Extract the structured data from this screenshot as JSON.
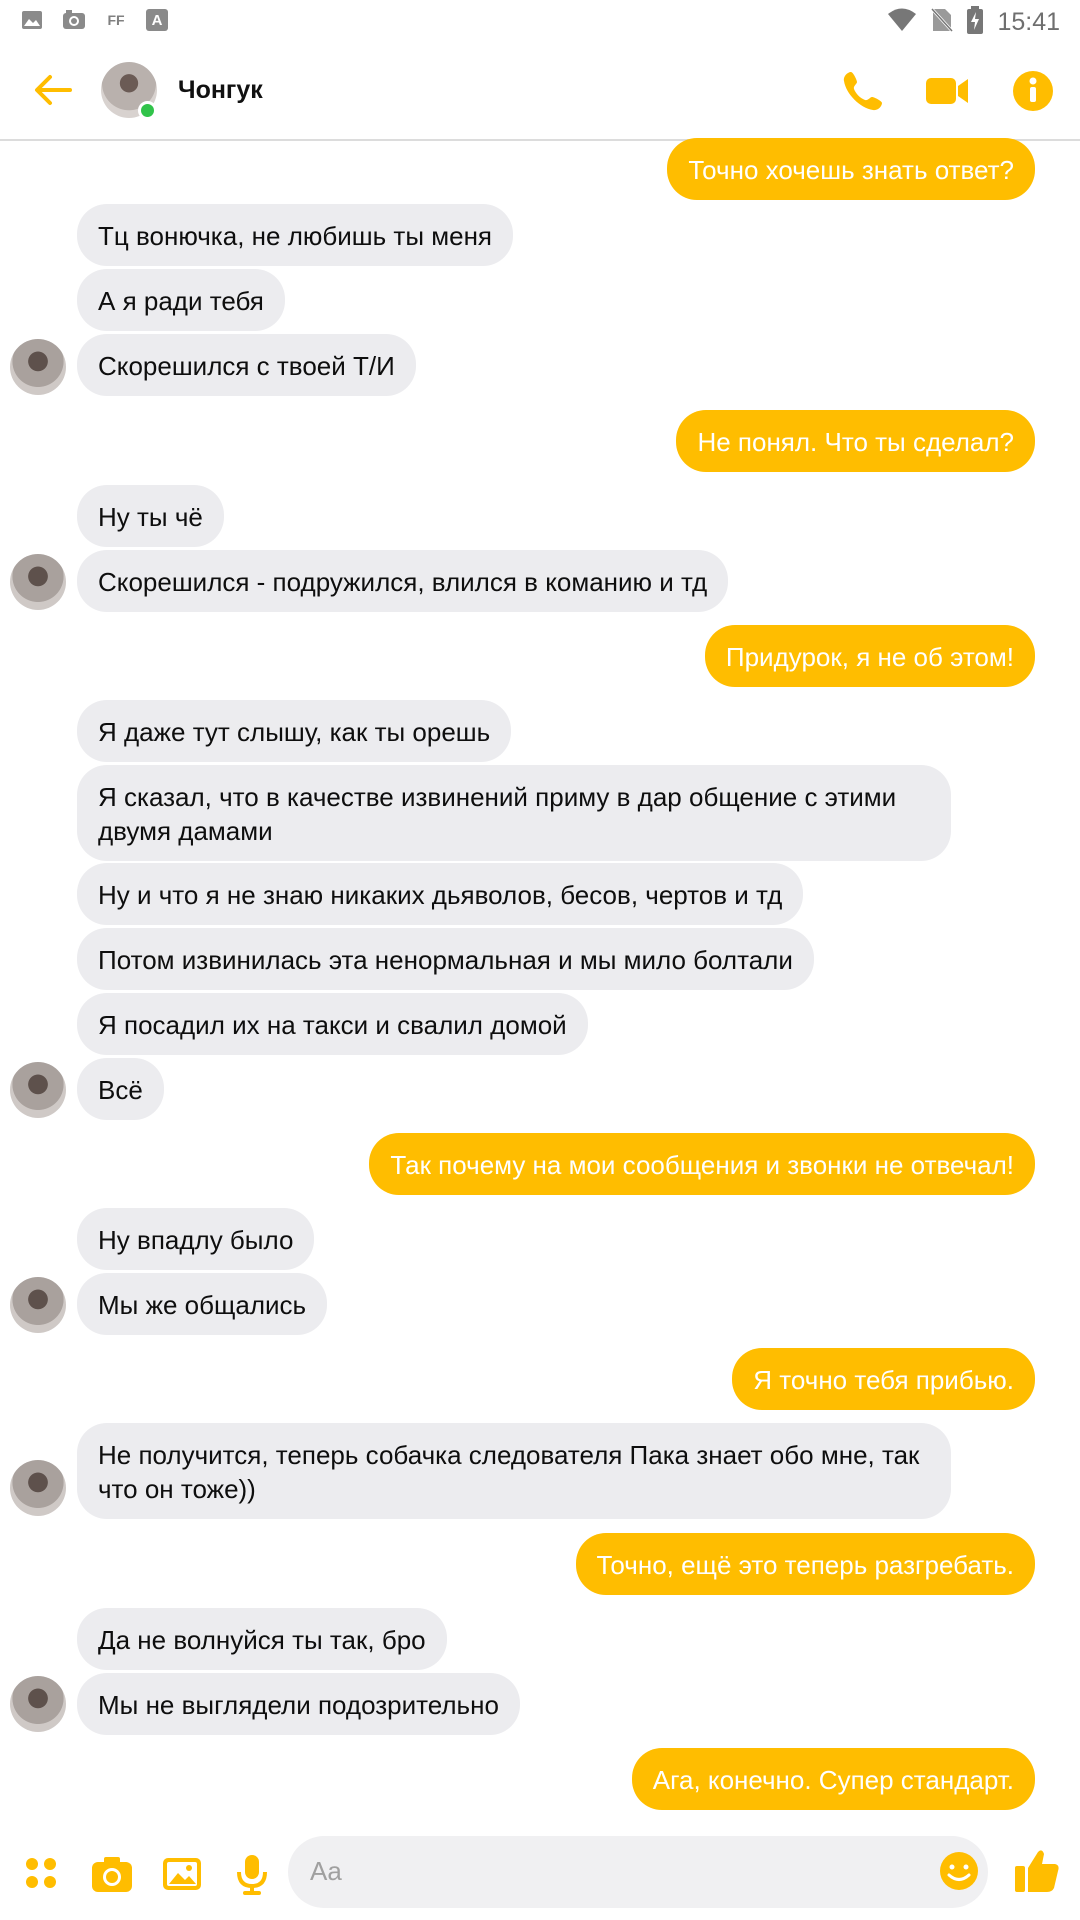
{
  "status_bar": {
    "time": "15:41",
    "left_icons": [
      "image-icon",
      "camera-notif-icon",
      "ff-icon",
      "a-icon"
    ],
    "ff_label": "FF",
    "a_label": "A"
  },
  "header": {
    "contact_name": "Чонгук",
    "online": true
  },
  "colors": {
    "accent": "#ffbd00",
    "incoming_bubble": "#ececef",
    "online": "#31c34a"
  },
  "messages": [
    {
      "dir": "out",
      "text": "Точно хочешь знать ответ?"
    },
    {
      "dir": "in",
      "text": "Тц вонючка, не любишь ты меня"
    },
    {
      "dir": "in",
      "text": "А я ради тебя"
    },
    {
      "dir": "in",
      "text": "Скорешился с твоей Т/И"
    },
    {
      "dir": "out",
      "text": "Не понял. Что ты сделал?"
    },
    {
      "dir": "in",
      "text": "Ну ты чё"
    },
    {
      "dir": "in",
      "text": "Скорешился - подружился, влился в команию и тд"
    },
    {
      "dir": "out",
      "text": "Придурок, я не об этом!"
    },
    {
      "dir": "in",
      "text": "Я даже тут слышу, как ты орешь"
    },
    {
      "dir": "in",
      "text": "Я сказал, что в качестве извинений приму в дар общение с этими двумя дамами"
    },
    {
      "dir": "in",
      "text": "Ну и что я не знаю никаких дьяволов, бесов, чертов и тд"
    },
    {
      "dir": "in",
      "text": "Потом извинилась эта ненормальная и мы мило болтали"
    },
    {
      "dir": "in",
      "text": "Я посадил их на такси и свалил домой"
    },
    {
      "dir": "in",
      "text": "Всё"
    },
    {
      "dir": "out",
      "text": "Так почему на мои сообщения и звонки не отвечал!"
    },
    {
      "dir": "in",
      "text": "Ну впадлу было"
    },
    {
      "dir": "in",
      "text": "Мы же общались"
    },
    {
      "dir": "out",
      "text": "Я точно тебя прибью."
    },
    {
      "dir": "in",
      "text": "Не получится, теперь собачка следователя Пака знает обо мне, так что он тоже))"
    },
    {
      "dir": "out",
      "text": "Точно, ещё это теперь разгребать."
    },
    {
      "dir": "in",
      "text": "Да не волнуйся ты так, бро"
    },
    {
      "dir": "in",
      "text": "Мы не выглядели подозрительно"
    },
    {
      "dir": "out",
      "text": "Ага, конечно. Супер стандарт."
    }
  ],
  "composer": {
    "placeholder": "Aa"
  }
}
